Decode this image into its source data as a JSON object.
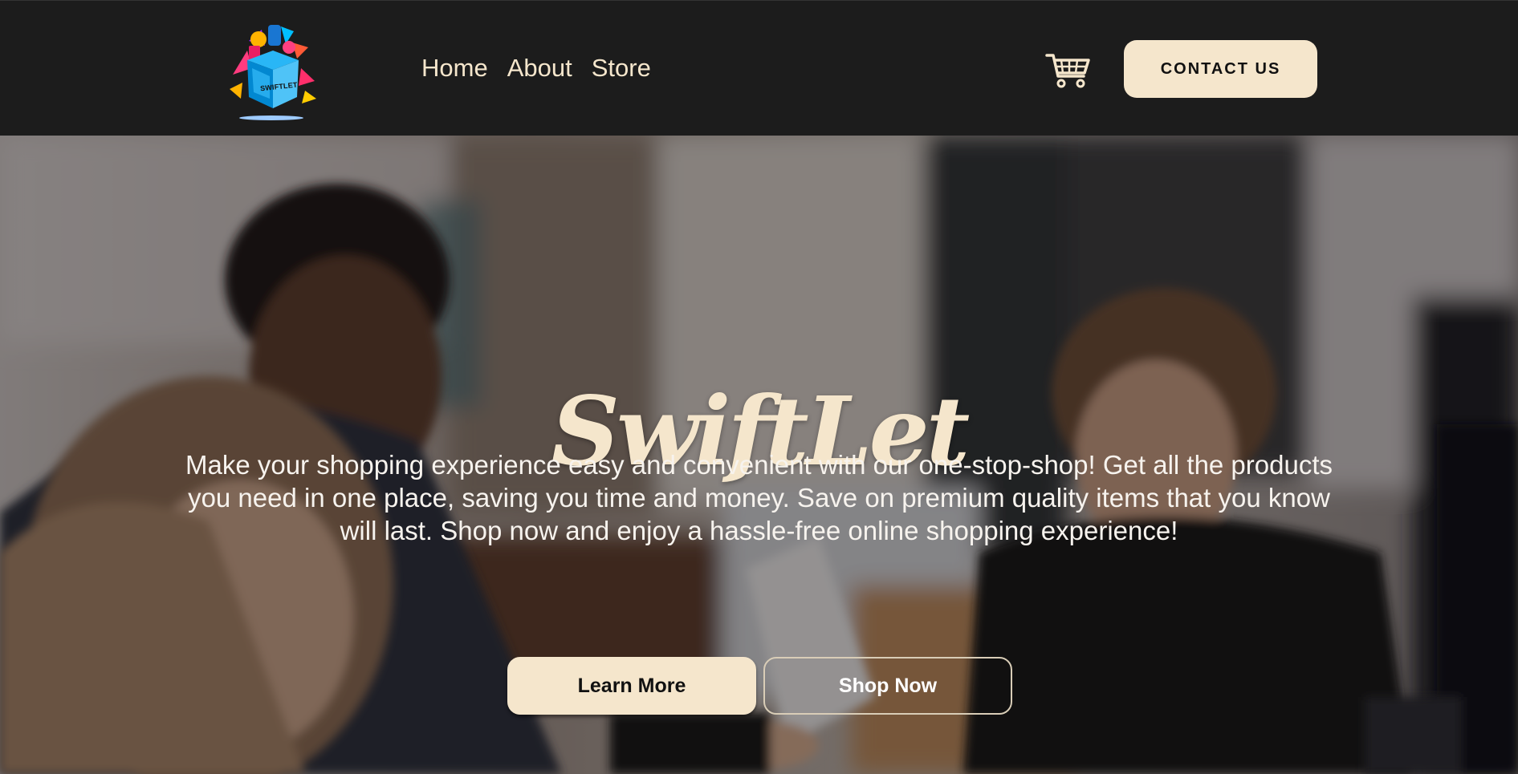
{
  "header": {
    "logo_text": "SWIFTLET",
    "logo_icon": "shopping-box-logo",
    "nav": [
      {
        "label": "Home"
      },
      {
        "label": "About"
      },
      {
        "label": "Store"
      }
    ],
    "cart_icon": "shopping-cart-icon",
    "contact_label": "CONTACT US"
  },
  "hero": {
    "background": "shop-counter-photo",
    "title": "SwiftLet",
    "description": "Make your shopping experience easy and convenient with our one-stop-shop! Get all the products you need in one place, saving you time and money. Save on premium quality items that you know will last. Shop now and enjoy a hassle-free online shopping experience!",
    "primary_button": "Learn More",
    "secondary_button": "Shop Now"
  },
  "colors": {
    "nav_background": "#1c1c1c",
    "accent_cream": "#f5e6cc",
    "text_light": "#f7f3ee"
  }
}
